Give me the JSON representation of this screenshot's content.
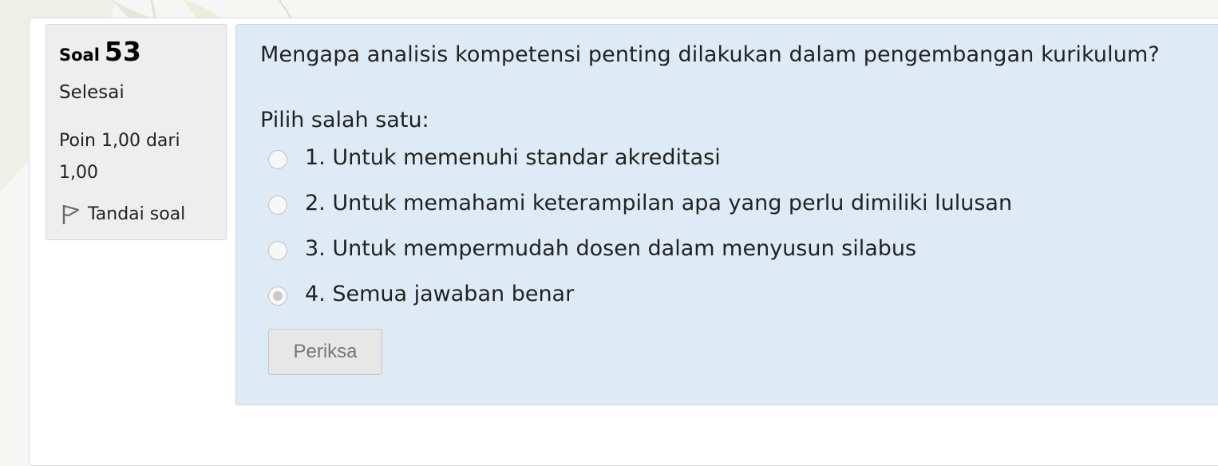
{
  "question_info": {
    "label": "Soal",
    "number": "53",
    "state": "Selesai",
    "grade": "Poin 1,00 dari 1,00",
    "flag_label": "Tandai soal"
  },
  "question": {
    "text": "Mengapa analisis kompetensi penting dilakukan dalam pengembangan kurikulum?",
    "prompt": "Pilih salah satu:",
    "options": [
      {
        "label": "1. Untuk memenuhi standar akreditasi",
        "selected": false
      },
      {
        "label": "2. Untuk memahami keterampilan apa yang perlu dimiliki lulusan",
        "selected": false
      },
      {
        "label": "3. Untuk mempermudah dosen dalam menyusun silabus",
        "selected": false
      },
      {
        "label": "4. Semua jawaban benar",
        "selected": true
      }
    ],
    "check_button": "Periksa"
  },
  "icons": {
    "flag": "flag-icon",
    "radio": "radio-icon"
  },
  "colors": {
    "content_background": "#deebf6",
    "info_background": "#eeeeee",
    "page_background": "#ffffff"
  }
}
